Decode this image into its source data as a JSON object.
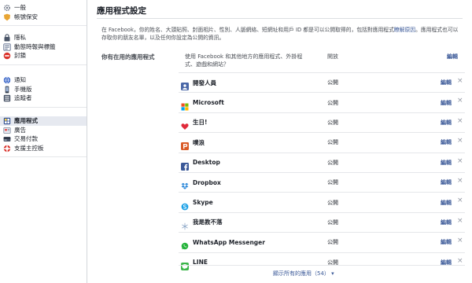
{
  "sidebar": {
    "groups": [
      [
        {
          "label": "一般",
          "icon": "gear-icon"
        },
        {
          "label": "帳號保安",
          "icon": "shield-icon"
        }
      ],
      [
        {
          "label": "隱私",
          "icon": "lock-icon"
        },
        {
          "label": "動態時報與標籤",
          "icon": "timeline-icon"
        },
        {
          "label": "封鎖",
          "icon": "block-icon"
        }
      ],
      [
        {
          "label": "通知",
          "icon": "globe-icon"
        },
        {
          "label": "手機版",
          "icon": "mobile-icon"
        },
        {
          "label": "追蹤者",
          "icon": "rss-icon"
        }
      ],
      [
        {
          "label": "應用程式",
          "icon": "apps-icon",
          "active": true
        },
        {
          "label": "廣告",
          "icon": "ads-icon"
        },
        {
          "label": "交易付款",
          "icon": "payments-icon"
        },
        {
          "label": "支援主控板",
          "icon": "lifebuoy-icon"
        }
      ]
    ]
  },
  "main": {
    "title": "應用程式設定",
    "description_text": "在 Facebook，你的姓名、大頭貼照、封面相片、性別、人脈網絡、短網址和用戶 ID 都是可以公開取得的，包括對應用程式",
    "description_link": "瞭解原因",
    "description_rest": "。應用程式也可以存取你的朋友名單，以及任何你設定為公開的資訊。",
    "section_label": "你有在用的應用程式",
    "header_desc": "使用 Facebook 和其他地方的應用程式、外掛程式、遊戲和網站？",
    "header_access": "開放",
    "header_edit": "編輯",
    "apps": [
      {
        "name": "開發人員",
        "access": "公開",
        "edit": "編輯",
        "remove": "×",
        "icon": "developer-icon",
        "color": "#4a67a7"
      },
      {
        "name": "Microsoft",
        "access": "公開",
        "edit": "編輯",
        "remove": "×",
        "icon": "microsoft-icon",
        "color": "#f25022"
      },
      {
        "name": "生日!",
        "access": "公開",
        "edit": "編輯",
        "remove": "×",
        "icon": "birthday-heart-icon",
        "color": "#e02a3a"
      },
      {
        "name": "噗浪",
        "access": "公開",
        "edit": "編輯",
        "remove": "×",
        "icon": "plurk-icon",
        "color": "#d95a26"
      },
      {
        "name": "Desktop",
        "access": "公開",
        "edit": "編輯",
        "remove": "×",
        "icon": "facebook-desktop-icon",
        "color": "#3b5998"
      },
      {
        "name": "Dropbox",
        "access": "公開",
        "edit": "編輯",
        "remove": "×",
        "icon": "dropbox-icon",
        "color": "#2c88d9"
      },
      {
        "name": "Skype",
        "access": "公開",
        "edit": "編輯",
        "remove": "×",
        "icon": "skype-icon",
        "color": "#1da1e6"
      },
      {
        "name": "我是教不落",
        "access": "公開",
        "edit": "編輯",
        "remove": "×",
        "icon": "snowflake-icon",
        "color": "#8fa9c9"
      },
      {
        "name": "WhatsApp Messenger",
        "access": "公開",
        "edit": "編輯",
        "remove": "×",
        "icon": "whatsapp-icon",
        "color": "#25b33b"
      },
      {
        "name": "LINE",
        "access": "公開",
        "edit": "編輯",
        "remove": "×",
        "icon": "line-icon",
        "color": "#3cb54a"
      }
    ],
    "show_all": "顯示所有的應用（54） ▾"
  }
}
